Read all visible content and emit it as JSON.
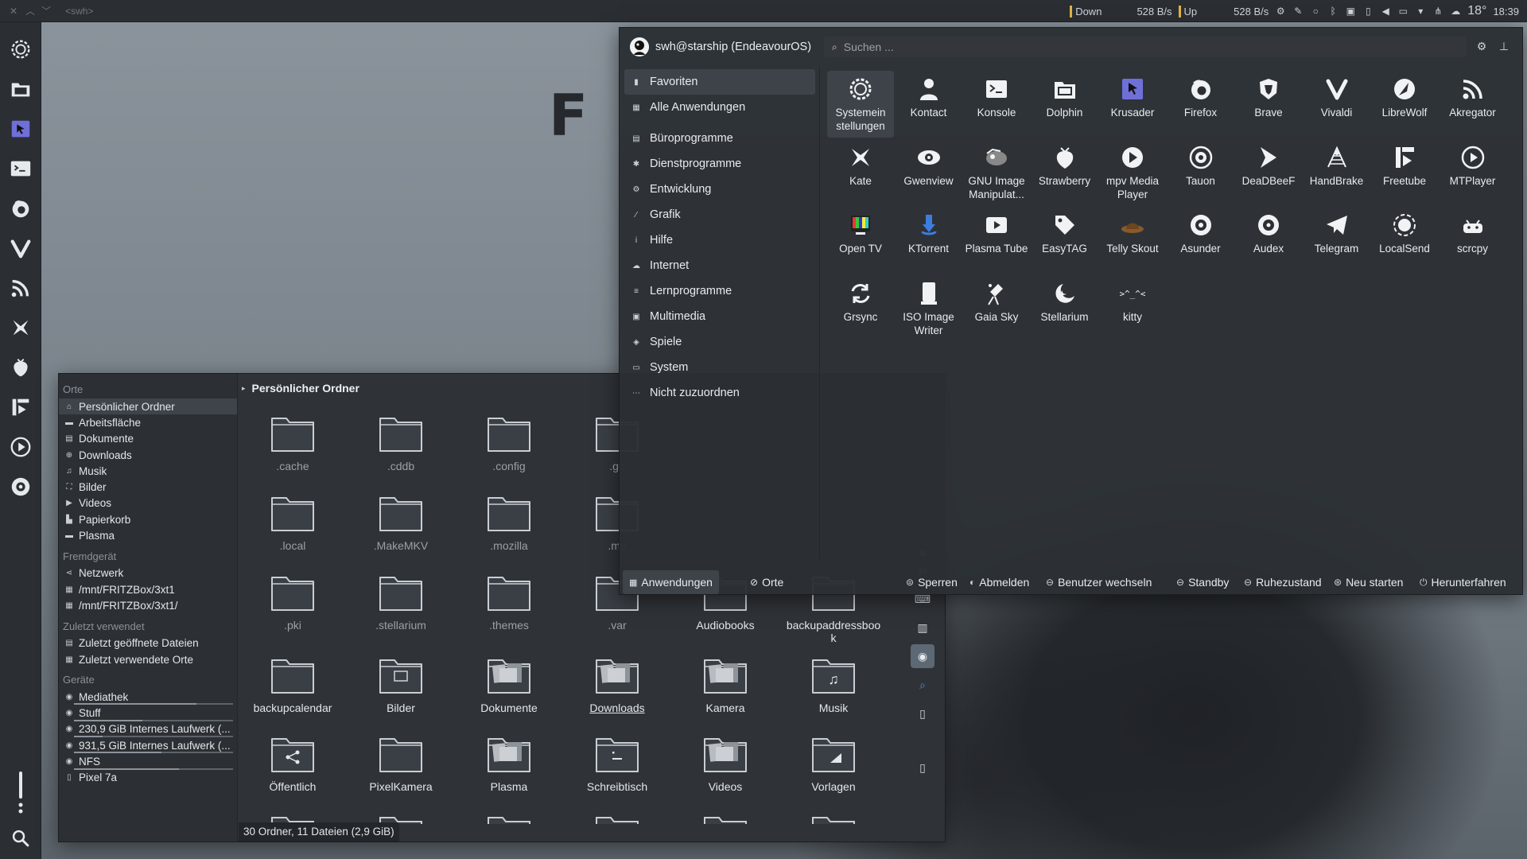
{
  "top_panel": {
    "window_title": "<swh>",
    "net_down_label": "Down",
    "net_down_value": "528 B/s",
    "net_up_label": "Up",
    "net_up_value": "528 B/s",
    "temperature": "18°",
    "clock": "18:39"
  },
  "file_manager": {
    "places_sections": [
      {
        "header": "Orte",
        "items": [
          "Persönlicher Ordner",
          "Arbeitsfläche",
          "Dokumente",
          "Downloads",
          "Musik",
          "Bilder",
          "Videos",
          "Papierkorb",
          "Plasma"
        ]
      },
      {
        "header": "Fremdgerät",
        "items": [
          "Netzwerk",
          "/mnt/FRITZBox/3xt1",
          "/mnt/FRITZBox/3xt1/"
        ]
      },
      {
        "header": "Zuletzt verwendet",
        "items": [
          "Zuletzt geöffnete Dateien",
          "Zuletzt verwendete Orte"
        ]
      },
      {
        "header": "Geräte",
        "items": [
          "Mediathek",
          "Stuff",
          "230,9 GiB Internes Laufwerk (...",
          "931,5 GiB Internes Laufwerk (...",
          "NFS",
          "Pixel 7a"
        ]
      }
    ],
    "breadcrumb": "Persönlicher Ordner",
    "files": [
      ".cache",
      ".cddb",
      ".config",
      ".gn",
      ".local",
      ".MakeMKV",
      ".mozilla",
      ".mu",
      ".pki",
      ".stellarium",
      ".themes",
      ".var",
      "Audiobooks",
      "backupaddressbook",
      "backupcalendar",
      "Bilder",
      "Dokumente",
      "Downloads",
      "Kamera",
      "Musik",
      "Öffentlich",
      "PixelKamera",
      "Plasma",
      "Schreibtisch",
      "Videos",
      "Vorlagen"
    ],
    "status": "30 Ordner, 11 Dateien (2,9 GiB)"
  },
  "launcher": {
    "user": "swh@starship (EndeavourOS)",
    "search_placeholder": "Suchen ...",
    "categories": [
      "Favoriten",
      "Alle Anwendungen",
      "Büroprogramme",
      "Dienstprogramme",
      "Entwicklung",
      "Grafik",
      "Hilfe",
      "Internet",
      "Lernprogramme",
      "Multimedia",
      "Spiele",
      "System",
      "Nicht zuzuordnen"
    ],
    "apps": [
      "Systemeinstellungen",
      "Kontact",
      "Konsole",
      "Dolphin",
      "Krusader",
      "Firefox",
      "Brave",
      "Vivaldi",
      "LibreWolf",
      "Akregator",
      "Kate",
      "Gwenview",
      "GNU Image Manipulat...",
      "Strawberry",
      "mpv Media Player",
      "Tauon",
      "DeaDBeeF",
      "HandBrake",
      "Freetube",
      "MTPlayer",
      "Open TV",
      "KTorrent",
      "Plasma Tube",
      "EasyTAG",
      "Telly Skout",
      "Asunder",
      "Audex",
      "Telegram",
      "LocalSend",
      "scrcpy",
      "Grsync",
      "ISO Image Writer",
      "Gaia Sky",
      "Stellarium",
      "kitty"
    ],
    "kitty_glyph": ">^_^<",
    "tabs": [
      "Anwendungen",
      "Orte"
    ],
    "power": [
      "Sperren",
      "Abmelden",
      "Benutzer wechseln",
      "Standby",
      "Ruhezustand",
      "Neu starten",
      "Herunterfahren"
    ]
  }
}
